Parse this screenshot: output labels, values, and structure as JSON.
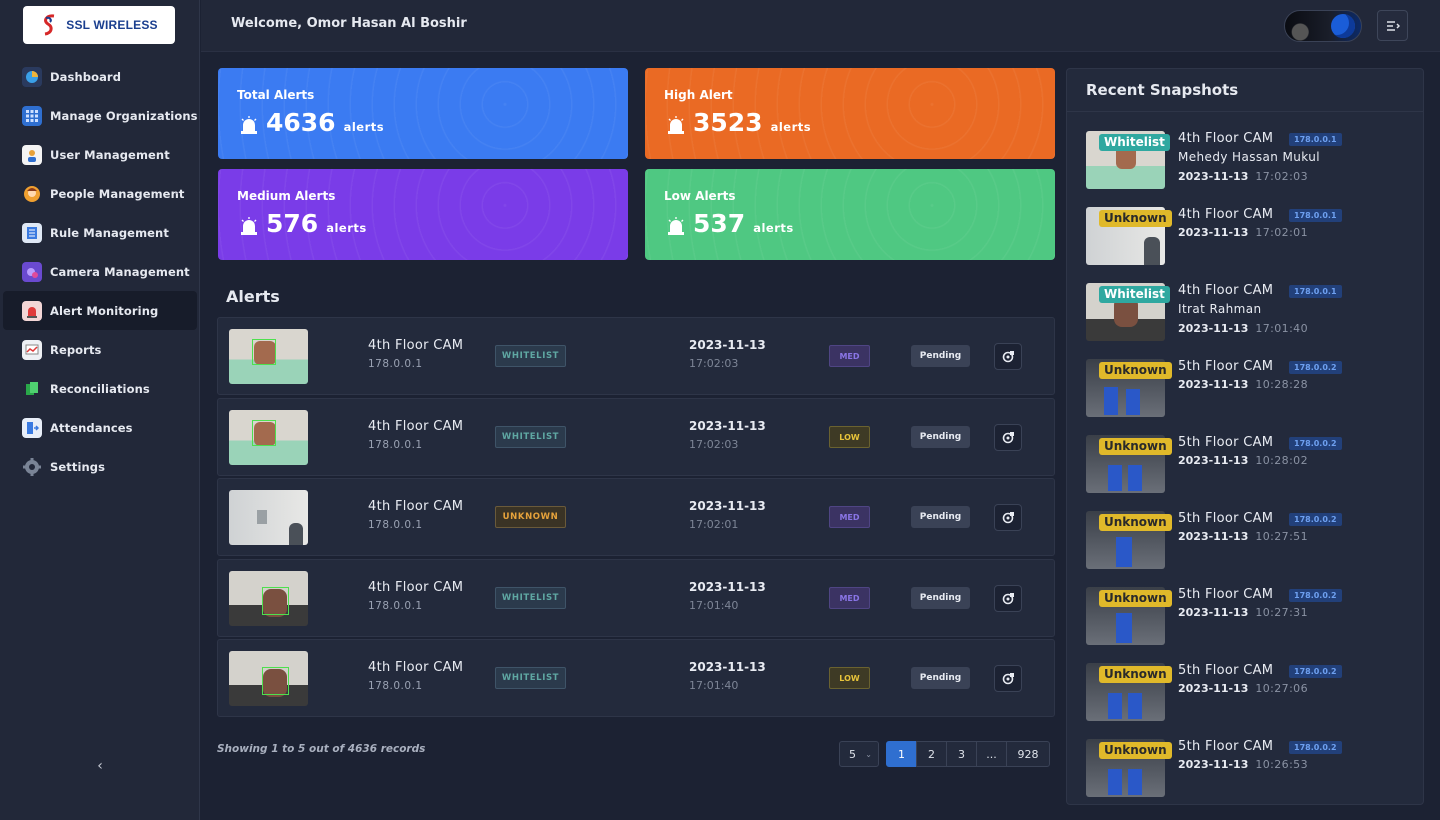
{
  "brand": {
    "logo_text": "SSL WIRELESS"
  },
  "header": {
    "welcome": "Welcome, Omor Hasan Al Boshir"
  },
  "sidebar": {
    "items": [
      {
        "label": "Dashboard",
        "icon": "dashboard-icon"
      },
      {
        "label": "Manage Organizations",
        "icon": "organizations-icon"
      },
      {
        "label": "User Management",
        "icon": "user-icon"
      },
      {
        "label": "People Management",
        "icon": "people-icon"
      },
      {
        "label": "Rule Management",
        "icon": "rule-icon"
      },
      {
        "label": "Camera Management",
        "icon": "camera-icon"
      },
      {
        "label": "Alert Monitoring",
        "icon": "alert-icon"
      },
      {
        "label": "Reports",
        "icon": "reports-icon"
      },
      {
        "label": "Reconciliations",
        "icon": "reconciliation-icon"
      },
      {
        "label": "Attendances",
        "icon": "attendance-icon"
      },
      {
        "label": "Settings",
        "icon": "settings-icon"
      }
    ],
    "active_item": "Alert Monitoring",
    "collapse_glyph": "‹"
  },
  "stats": {
    "total": {
      "title": "Total Alerts",
      "value": "4636",
      "unit": "alerts",
      "color": "#3b7bf2"
    },
    "high": {
      "title": "High Alert",
      "value": "3523",
      "unit": "alerts",
      "color": "#ea6a24"
    },
    "medium": {
      "title": "Medium Alerts",
      "value": "576",
      "unit": "alerts",
      "color": "#7a3ce8"
    },
    "low": {
      "title": "Low Alerts",
      "value": "537",
      "unit": "alerts",
      "color": "#4fc882"
    }
  },
  "alerts": {
    "title": "Alerts",
    "rows": [
      {
        "camera": "4th Floor CAM",
        "ip": "178.0.0.1",
        "tag": "WHITELIST",
        "date": "2023-11-13",
        "time": "17:02:03",
        "level": "MED",
        "status": "Pending"
      },
      {
        "camera": "4th Floor CAM",
        "ip": "178.0.0.1",
        "tag": "WHITELIST",
        "date": "2023-11-13",
        "time": "17:02:03",
        "level": "LOW",
        "status": "Pending"
      },
      {
        "camera": "4th Floor CAM",
        "ip": "178.0.0.1",
        "tag": "UNKNOWN",
        "date": "2023-11-13",
        "time": "17:02:01",
        "level": "MED",
        "status": "Pending"
      },
      {
        "camera": "4th Floor CAM",
        "ip": "178.0.0.1",
        "tag": "WHITELIST",
        "date": "2023-11-13",
        "time": "17:01:40",
        "level": "MED",
        "status": "Pending"
      },
      {
        "camera": "4th Floor CAM",
        "ip": "178.0.0.1",
        "tag": "WHITELIST",
        "date": "2023-11-13",
        "time": "17:01:40",
        "level": "LOW",
        "status": "Pending"
      }
    ],
    "showing": "Showing 1 to 5 out of 4636 records",
    "page_size": "5",
    "pages": [
      "1",
      "2",
      "3",
      "...",
      "928"
    ]
  },
  "snapshots": {
    "title": "Recent Snapshots",
    "items": [
      {
        "badge": "Whitelist",
        "camera": "4th Floor CAM",
        "ip": "178.0.0.1",
        "name": "Mehedy Hassan Mukul",
        "date": "2023-11-13",
        "time": "17:02:03"
      },
      {
        "badge": "Unknown",
        "camera": "4th Floor CAM",
        "ip": "178.0.0.1",
        "name": "",
        "date": "2023-11-13",
        "time": "17:02:01"
      },
      {
        "badge": "Whitelist",
        "camera": "4th Floor CAM",
        "ip": "178.0.0.1",
        "name": "Itrat Rahman",
        "date": "2023-11-13",
        "time": "17:01:40"
      },
      {
        "badge": "Unknown",
        "camera": "5th Floor CAM",
        "ip": "178.0.0.2",
        "name": "",
        "date": "2023-11-13",
        "time": "10:28:28"
      },
      {
        "badge": "Unknown",
        "camera": "5th Floor CAM",
        "ip": "178.0.0.2",
        "name": "",
        "date": "2023-11-13",
        "time": "10:28:02"
      },
      {
        "badge": "Unknown",
        "camera": "5th Floor CAM",
        "ip": "178.0.0.2",
        "name": "",
        "date": "2023-11-13",
        "time": "10:27:51"
      },
      {
        "badge": "Unknown",
        "camera": "5th Floor CAM",
        "ip": "178.0.0.2",
        "name": "",
        "date": "2023-11-13",
        "time": "10:27:31"
      },
      {
        "badge": "Unknown",
        "camera": "5th Floor CAM",
        "ip": "178.0.0.2",
        "name": "",
        "date": "2023-11-13",
        "time": "10:27:06"
      },
      {
        "badge": "Unknown",
        "camera": "5th Floor CAM",
        "ip": "178.0.0.2",
        "name": "",
        "date": "2023-11-13",
        "time": "10:26:53"
      }
    ]
  }
}
